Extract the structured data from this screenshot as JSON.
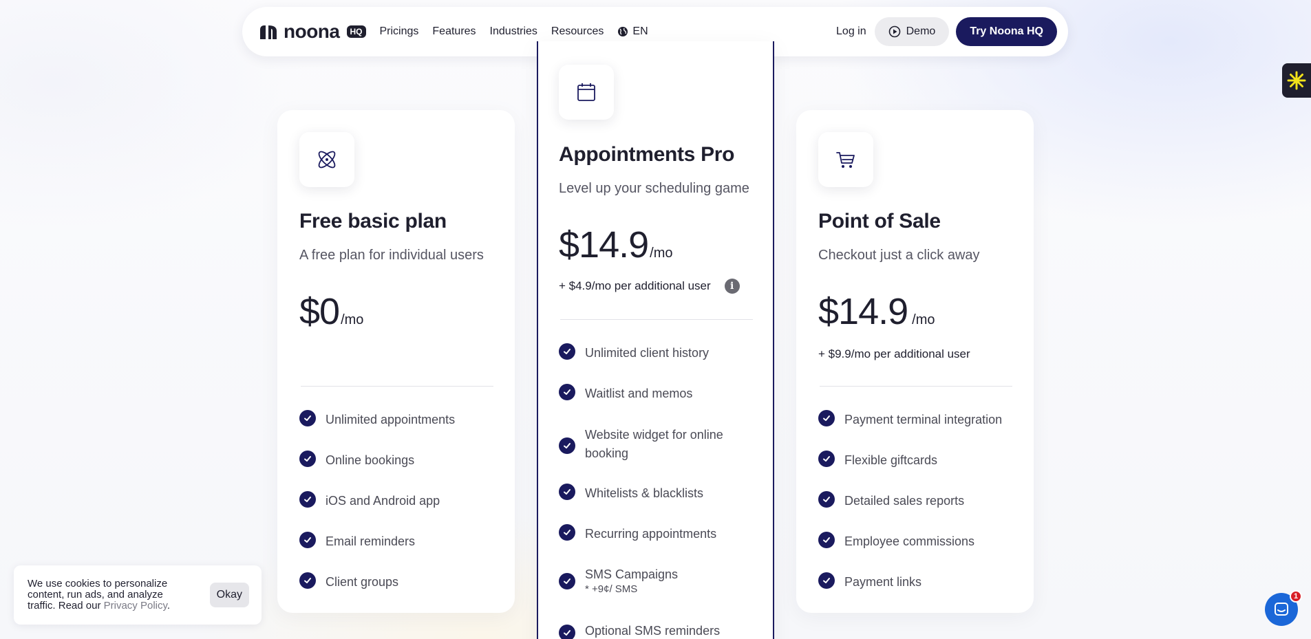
{
  "nav": {
    "logo_text": "noona",
    "logo_badge": "HQ",
    "links": [
      "Pricings",
      "Features",
      "Industries",
      "Resources"
    ],
    "language": "EN",
    "login": "Log in",
    "demo": "Demo",
    "cta": "Try Noona HQ"
  },
  "plans": [
    {
      "title": "Free basic plan",
      "subtitle": "A free plan for individual users",
      "price": "$0",
      "per": "/mo",
      "features": [
        "Unlimited appointments",
        "Online bookings",
        "iOS and Android app",
        "Email reminders",
        "Client groups"
      ]
    },
    {
      "title": "Appointments Pro",
      "subtitle": "Level up your scheduling game",
      "price": "$14.9",
      "per": "/mo",
      "extra": "+ $4.9/mo per additional user",
      "features": [
        "Unlimited client history",
        "Waitlist and memos",
        "Website widget for online booking",
        "Whitelists & blacklists",
        "Recurring appointments",
        "SMS Campaigns",
        "Optional SMS reminders"
      ],
      "sms_note": "* +9¢/ SMS"
    },
    {
      "title": "Point of Sale",
      "subtitle": "Checkout just a click away",
      "price": "$14.9",
      "per": "/mo",
      "extra": "+ $9.9/mo per additional user",
      "features": [
        "Payment terminal integration",
        "Flexible giftcards",
        "Detailed sales reports",
        "Employee commissions",
        "Payment links"
      ]
    }
  ],
  "cookie": {
    "text": "We use cookies to personalize content, run ads, and analyze traffic. Read our",
    "link": "Privacy Policy",
    "period": ".",
    "button": "Okay"
  },
  "chat": {
    "badge": "1"
  },
  "icons": {
    "free": "atom-icon",
    "pro": "calendar-icon",
    "pos": "shopping-cart-icon"
  },
  "colors": {
    "primary": "#1a1a5e",
    "chat": "#1b67d8",
    "badge": "#d81f26",
    "widget_accent": "#f2e21a"
  }
}
